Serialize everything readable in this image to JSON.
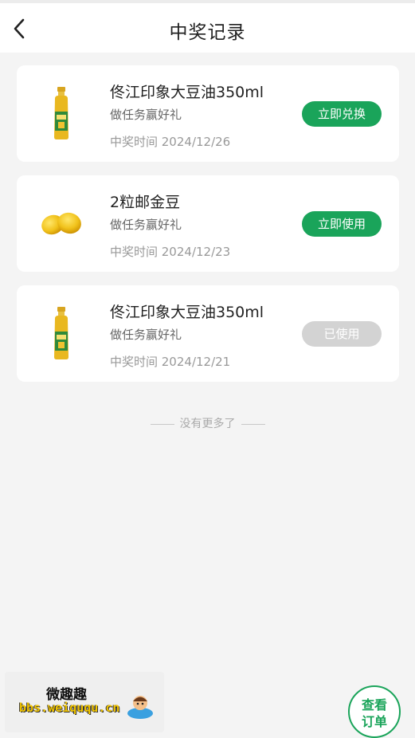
{
  "header": {
    "title": "中奖记录",
    "back_icon": "chevron-left-icon"
  },
  "records": [
    {
      "name": "佟江印象大豆油350ml",
      "subtitle": "做任务赢好礼",
      "time": "中奖时间 2024/12/26",
      "action": "立即兑换",
      "status": "active",
      "image": "soybean-oil-bottle-icon"
    },
    {
      "name": "2粒邮金豆",
      "subtitle": "做任务赢好礼",
      "time": "中奖时间 2024/12/23",
      "action": "立即使用",
      "status": "active",
      "image": "golden-beans-icon"
    },
    {
      "name": "佟江印象大豆油350ml",
      "subtitle": "做任务赢好礼",
      "time": "中奖时间 2024/12/21",
      "action": "已使用",
      "status": "used",
      "image": "soybean-oil-bottle-icon"
    }
  ],
  "footer": {
    "no_more": "没有更多了"
  },
  "watermark": {
    "title": "微趣趣",
    "url": "bbs.weiququ.cn"
  },
  "orders_button": {
    "line1": "查看",
    "line2": "订单"
  },
  "colors": {
    "accent": "#1aa45a",
    "disabled": "#d3d3d3",
    "background": "#f4f4f4"
  }
}
